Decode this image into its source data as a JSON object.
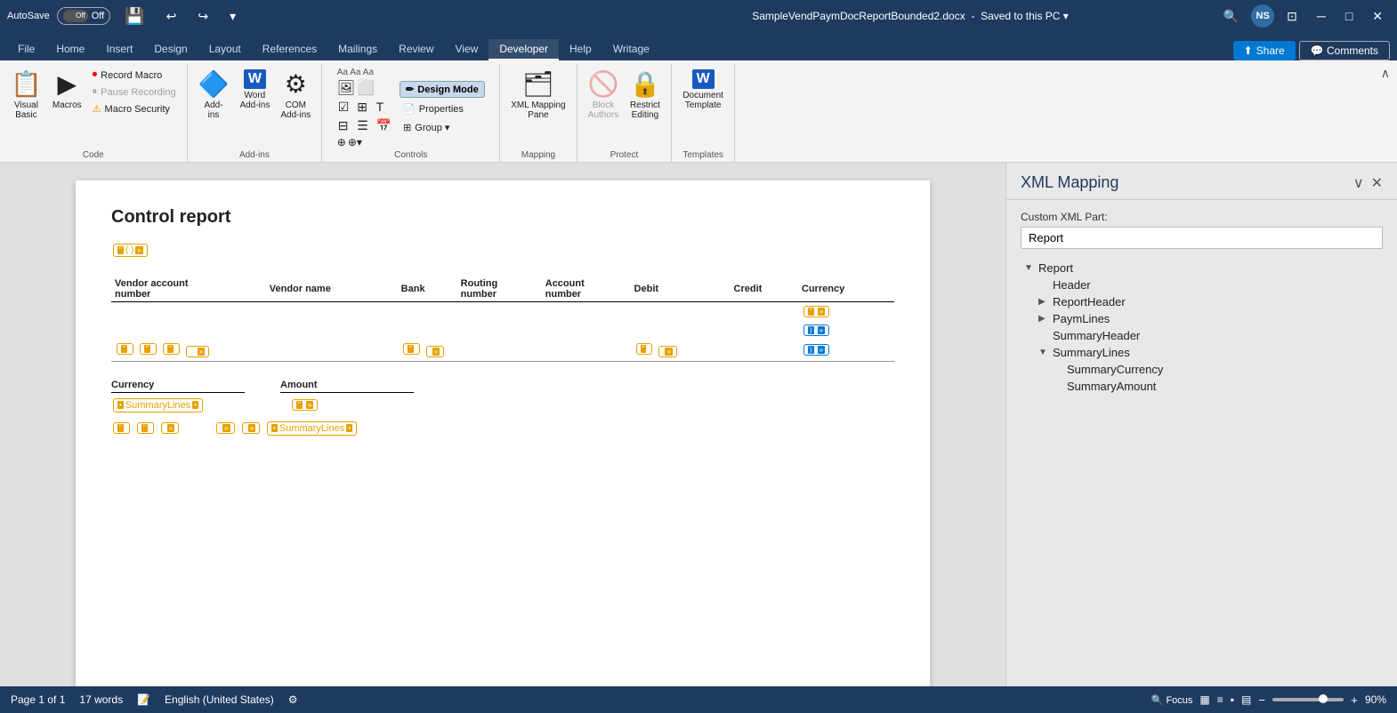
{
  "titleBar": {
    "autosave_label": "AutoSave",
    "autosave_state": "Off",
    "filename": "SampleVendPaymDocReportBounded2.docx",
    "save_status": "Saved to this PC",
    "user_initials": "NS",
    "minimize": "─",
    "maximize": "□",
    "close": "✕"
  },
  "tabs": {
    "items": [
      "File",
      "Home",
      "Insert",
      "Design",
      "Layout",
      "References",
      "Mailings",
      "Review",
      "View",
      "Developer",
      "Help",
      "Writage"
    ],
    "active": "Developer",
    "share_label": "Share",
    "comments_label": "Comments"
  },
  "ribbon": {
    "groups": [
      {
        "name": "Code",
        "label": "Code",
        "items": [
          {
            "id": "visual-basic",
            "label": "Visual\nBasic",
            "icon": "📋"
          },
          {
            "id": "macros",
            "label": "Macros",
            "icon": "▶"
          },
          {
            "id": "record-macro",
            "label": "Record Macro",
            "icon": "⏺",
            "type": "small"
          },
          {
            "id": "pause-recording",
            "label": "Pause Recording",
            "icon": "⏸",
            "type": "small",
            "disabled": true
          },
          {
            "id": "macro-security",
            "label": "Macro Security",
            "icon": "⚠",
            "type": "small"
          }
        ]
      },
      {
        "name": "Add-ins",
        "label": "Add-ins",
        "items": [
          {
            "id": "add-ins",
            "label": "Add-\nins",
            "icon": "🔷"
          },
          {
            "id": "word-add-ins",
            "label": "Word\nAdd-ins",
            "icon": "W"
          },
          {
            "id": "com-add-ins",
            "label": "COM\nAdd-ins",
            "icon": "⚙"
          }
        ]
      },
      {
        "name": "Controls",
        "label": "Controls",
        "items": [
          {
            "id": "design-mode",
            "label": "Design Mode",
            "icon": "✏",
            "active": true
          },
          {
            "id": "properties",
            "label": "Properties",
            "icon": "📄"
          },
          {
            "id": "group",
            "label": "Group ▾",
            "icon": "⊞"
          }
        ]
      },
      {
        "name": "Mapping",
        "label": "Mapping",
        "items": [
          {
            "id": "xml-mapping-pane",
            "label": "XML Mapping\nPane",
            "icon": "🗂"
          }
        ]
      },
      {
        "name": "Protect",
        "label": "Protect",
        "items": [
          {
            "id": "block-authors",
            "label": "Block\nAuthors",
            "icon": "🚫",
            "disabled": true
          },
          {
            "id": "restrict-editing",
            "label": "Restrict\nEditing",
            "icon": "🔒"
          }
        ]
      },
      {
        "name": "Templates",
        "label": "Templates",
        "items": [
          {
            "id": "document-template",
            "label": "Document\nTemplate",
            "icon": "W"
          }
        ]
      }
    ],
    "collapse_label": "∧"
  },
  "document": {
    "title": "Control report",
    "table": {
      "headers": [
        "Vendor account\nnumber",
        "Vendor name",
        "Bank",
        "Routing\nnumber",
        "Account\nnumber",
        "Debit",
        "Credit",
        "Currency"
      ],
      "rows": []
    },
    "summary": {
      "col1_header": "Currency",
      "col2_header": "Amount",
      "summarylines_label": "SummaryLines",
      "summaryamount_label": "SummaryLines"
    }
  },
  "xmlPanel": {
    "title": "XML Mapping",
    "custom_xml_part_label": "Custom XML Part:",
    "selected_part": "Report",
    "close_btn": "✕",
    "collapse_btn": "∨",
    "tree": [
      {
        "id": "report",
        "label": "Report",
        "indent": 0,
        "arrow": "▼",
        "expanded": true
      },
      {
        "id": "header",
        "label": "Header",
        "indent": 1,
        "arrow": ""
      },
      {
        "id": "report-header",
        "label": "ReportHeader",
        "indent": 1,
        "arrow": "▶"
      },
      {
        "id": "paym-lines",
        "label": "PaymLines",
        "indent": 1,
        "arrow": "▶"
      },
      {
        "id": "summary-header",
        "label": "SummaryHeader",
        "indent": 1,
        "arrow": ""
      },
      {
        "id": "summary-lines",
        "label": "SummaryLines",
        "indent": 1,
        "arrow": "▼",
        "expanded": true,
        "selected": false
      },
      {
        "id": "summary-currency",
        "label": "SummaryCurrency",
        "indent": 2,
        "arrow": ""
      },
      {
        "id": "summary-amount",
        "label": "SummaryAmount",
        "indent": 2,
        "arrow": ""
      }
    ]
  },
  "statusBar": {
    "page_info": "Page 1 of 1",
    "word_count": "17 words",
    "language": "English (United States)",
    "focus_label": "Focus",
    "zoom_pct": "90%",
    "zoom_in": "+",
    "zoom_out": "−"
  }
}
